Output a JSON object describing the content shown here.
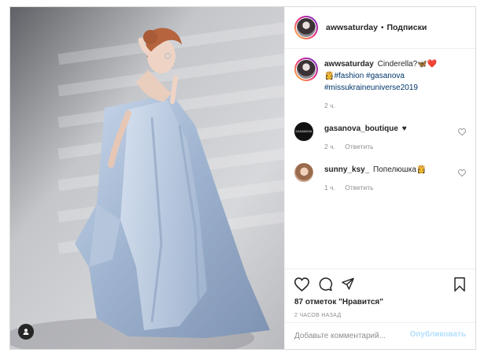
{
  "post": {
    "author": "awwsaturday",
    "separator": "•",
    "follow_label": "Подписки"
  },
  "caption": {
    "user": "awwsaturday",
    "text": "Cinderella?🦋❤️",
    "emoji": "👸",
    "hashtags": [
      "#fashion",
      "#gasanova",
      "#missukraineuniverse2019"
    ],
    "time": "2 ч."
  },
  "comments": [
    {
      "user": "gasanova_boutique",
      "text": "♥",
      "time": "2 ч.",
      "reply_label": "Ответить",
      "avatar_text": "GASANOVA"
    },
    {
      "user": "sunny_ksy_",
      "text": "Попелюшка👸",
      "time": "1 ч.",
      "reply_label": "Ответить"
    }
  ],
  "actions": {
    "icons": [
      "heart-icon",
      "comment-icon",
      "share-icon",
      "bookmark-icon"
    ],
    "likes_text": "87 отметок \"Нравится\"",
    "time_ago": "2 ЧАСОВ НАЗАД"
  },
  "add_comment": {
    "placeholder": "Добавьте комментарий...",
    "publish_label": "Опубликовать"
  },
  "colors": {
    "link": "#00376b",
    "muted": "#8e8e8e",
    "publish_disabled": "#b2dffc",
    "border": "#dbdbdb"
  }
}
